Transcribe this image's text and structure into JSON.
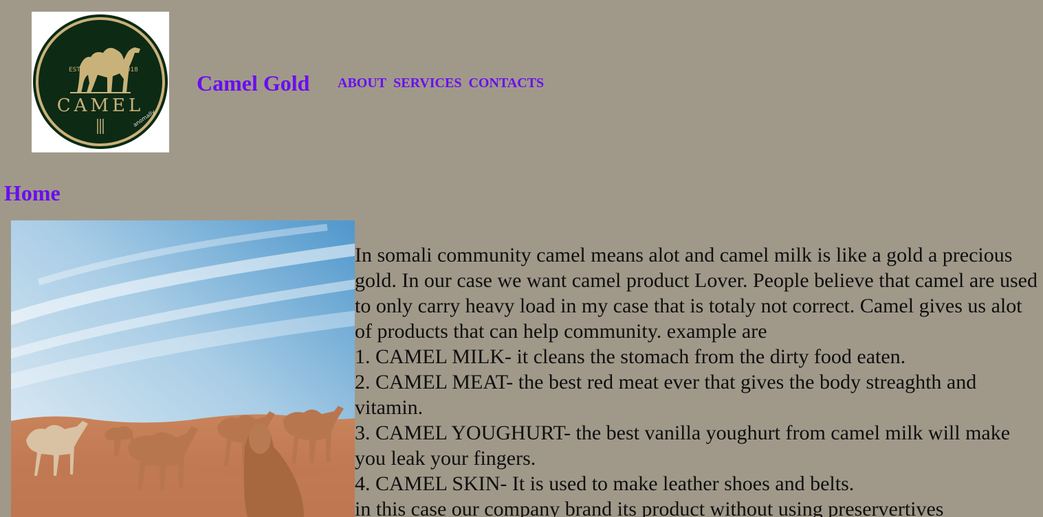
{
  "header": {
    "logo": {
      "name": "camel-gold-logo",
      "text_est": "EST.",
      "text_year": "2018",
      "text_name": "CAMEL",
      "text_watermark": "anomally"
    },
    "brand": "Camel Gold",
    "nav": [
      "ABOUT",
      "SERVICES",
      "CONTACTS"
    ]
  },
  "main": {
    "heading": "Home",
    "photo": "camels-in-desert-photo",
    "paragraphs": [
      "In somali community camel means alot and camel milk is like a gold a precious gold. In our case we want camel product Lover. People believe that camel are used to only carry heavy load in my case that is totaly not correct. Camel gives us alot of products that can help community. example are",
      "1. CAMEL MILK- it cleans the stomach from the dirty food eaten.",
      "2. CAMEL MEAT- the best red meat ever that gives the body streaghth and vitamin.",
      "3. CAMEL YOUGHURT- the best vanilla youghurt from camel milk will make you leak your fingers.",
      "4. CAMEL SKIN- It is used to make leather shoes and belts.",
      "in this case our company brand its product without using preservertives"
    ]
  },
  "colors": {
    "background": "#a0998a",
    "link": "#6a0df0",
    "text": "#0f0f0f",
    "logo_green": "#0d2a14",
    "logo_gold": "#c9b27a"
  }
}
